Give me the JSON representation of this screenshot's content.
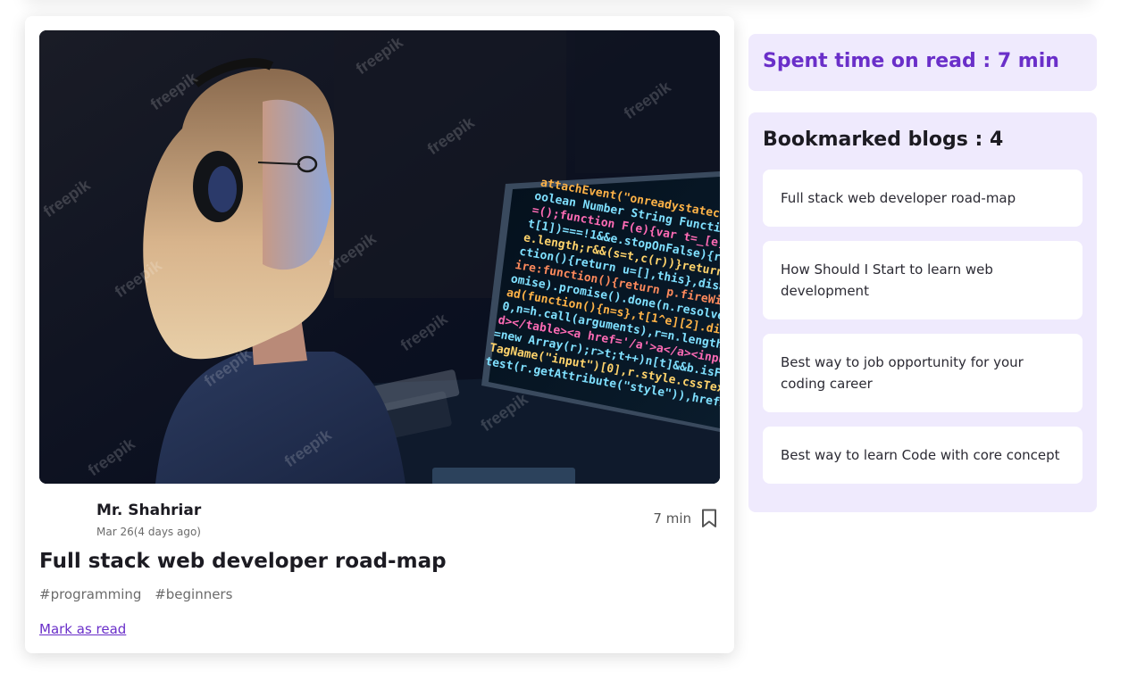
{
  "blog": {
    "author_name": "Mr. Shahriar",
    "date": "Mar 26(4 days ago)",
    "read_time": "7 min",
    "title": "Full stack web developer road-map",
    "tags": [
      "#programming",
      "#beginners"
    ],
    "mark_as_read_label": "Mark as read",
    "cover_image": "woman-coding-at-night-photo",
    "bookmark_icon": "bookmark-outline-icon"
  },
  "sidebar": {
    "spent_time_text": "Spent time on read : 7 min",
    "bookmarks_title": "Bookmarked blogs : 4",
    "bookmarks": [
      "Full stack web developer road-map",
      "How Should I Start to learn web development",
      "Best way to job opportunity for your coding career",
      "Best way to learn Code with core concept"
    ]
  },
  "colors": {
    "accent": "#6a2fc9",
    "sidebar_bg": "#efeafd",
    "text": "#1c1b22",
    "muted": "#6b6b6b"
  }
}
